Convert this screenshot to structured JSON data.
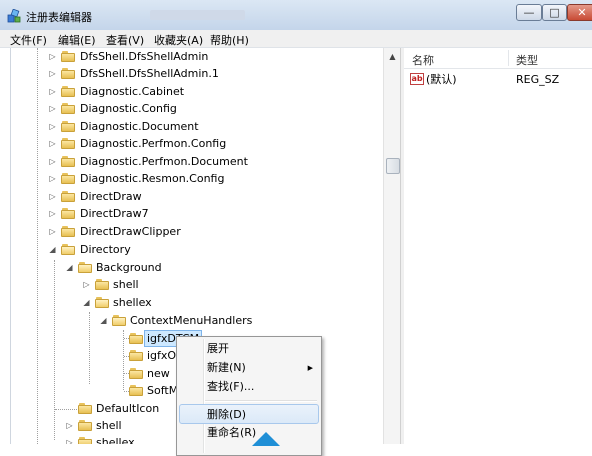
{
  "window": {
    "title": "注册表编辑器",
    "controls": {
      "minimize": "—",
      "maximize": "□",
      "close": "✕"
    }
  },
  "menubar": [
    "文件(F)",
    "编辑(E)",
    "查看(V)",
    "收藏夹(A)",
    "帮助(H)"
  ],
  "tree": {
    "items": [
      {
        "label": "DfsShell.DfsShellAdmin",
        "expander": "▷"
      },
      {
        "label": "DfsShell.DfsShellAdmin.1",
        "expander": "▷"
      },
      {
        "label": "Diagnostic.Cabinet",
        "expander": "▷"
      },
      {
        "label": "Diagnostic.Config",
        "expander": "▷"
      },
      {
        "label": "Diagnostic.Document",
        "expander": "▷"
      },
      {
        "label": "Diagnostic.Perfmon.Config",
        "expander": "▷"
      },
      {
        "label": "Diagnostic.Perfmon.Document",
        "expander": "▷"
      },
      {
        "label": "Diagnostic.Resmon.Config",
        "expander": "▷"
      },
      {
        "label": "DirectDraw",
        "expander": "▷"
      },
      {
        "label": "DirectDraw7",
        "expander": "▷"
      },
      {
        "label": "DirectDrawClipper",
        "expander": "▷"
      },
      {
        "label": "Directory",
        "expander": "◢"
      },
      {
        "label": "Background",
        "expander": "◢"
      },
      {
        "label": "shell",
        "expander": "▷"
      },
      {
        "label": "shellex",
        "expander": "◢"
      },
      {
        "label": "ContextMenuHandlers",
        "expander": "◢"
      },
      {
        "label": "igfxDTCM",
        "expander": ""
      },
      {
        "label": "igfxOSP",
        "expander": ""
      },
      {
        "label": "new",
        "expander": ""
      },
      {
        "label": "SoftMgr",
        "expander": ""
      },
      {
        "label": "DefaultIcon",
        "expander": ""
      },
      {
        "label": "shell",
        "expander": "▷"
      },
      {
        "label": "shellex",
        "expander": "▷"
      }
    ]
  },
  "list": {
    "columns": {
      "name": "名称",
      "type": "类型"
    },
    "rows": [
      {
        "icon": "ab",
        "name": "(默认)",
        "type": "REG_SZ"
      }
    ]
  },
  "context_menu": {
    "items": [
      {
        "label": "展开"
      },
      {
        "label": "新建(N)",
        "submenu_arrow": "▶"
      },
      {
        "label": "查找(F)..."
      },
      {
        "label": "删除(D)"
      },
      {
        "label": "重命名(R)"
      }
    ]
  },
  "scrollbar": {
    "up_arrow": "▲"
  }
}
